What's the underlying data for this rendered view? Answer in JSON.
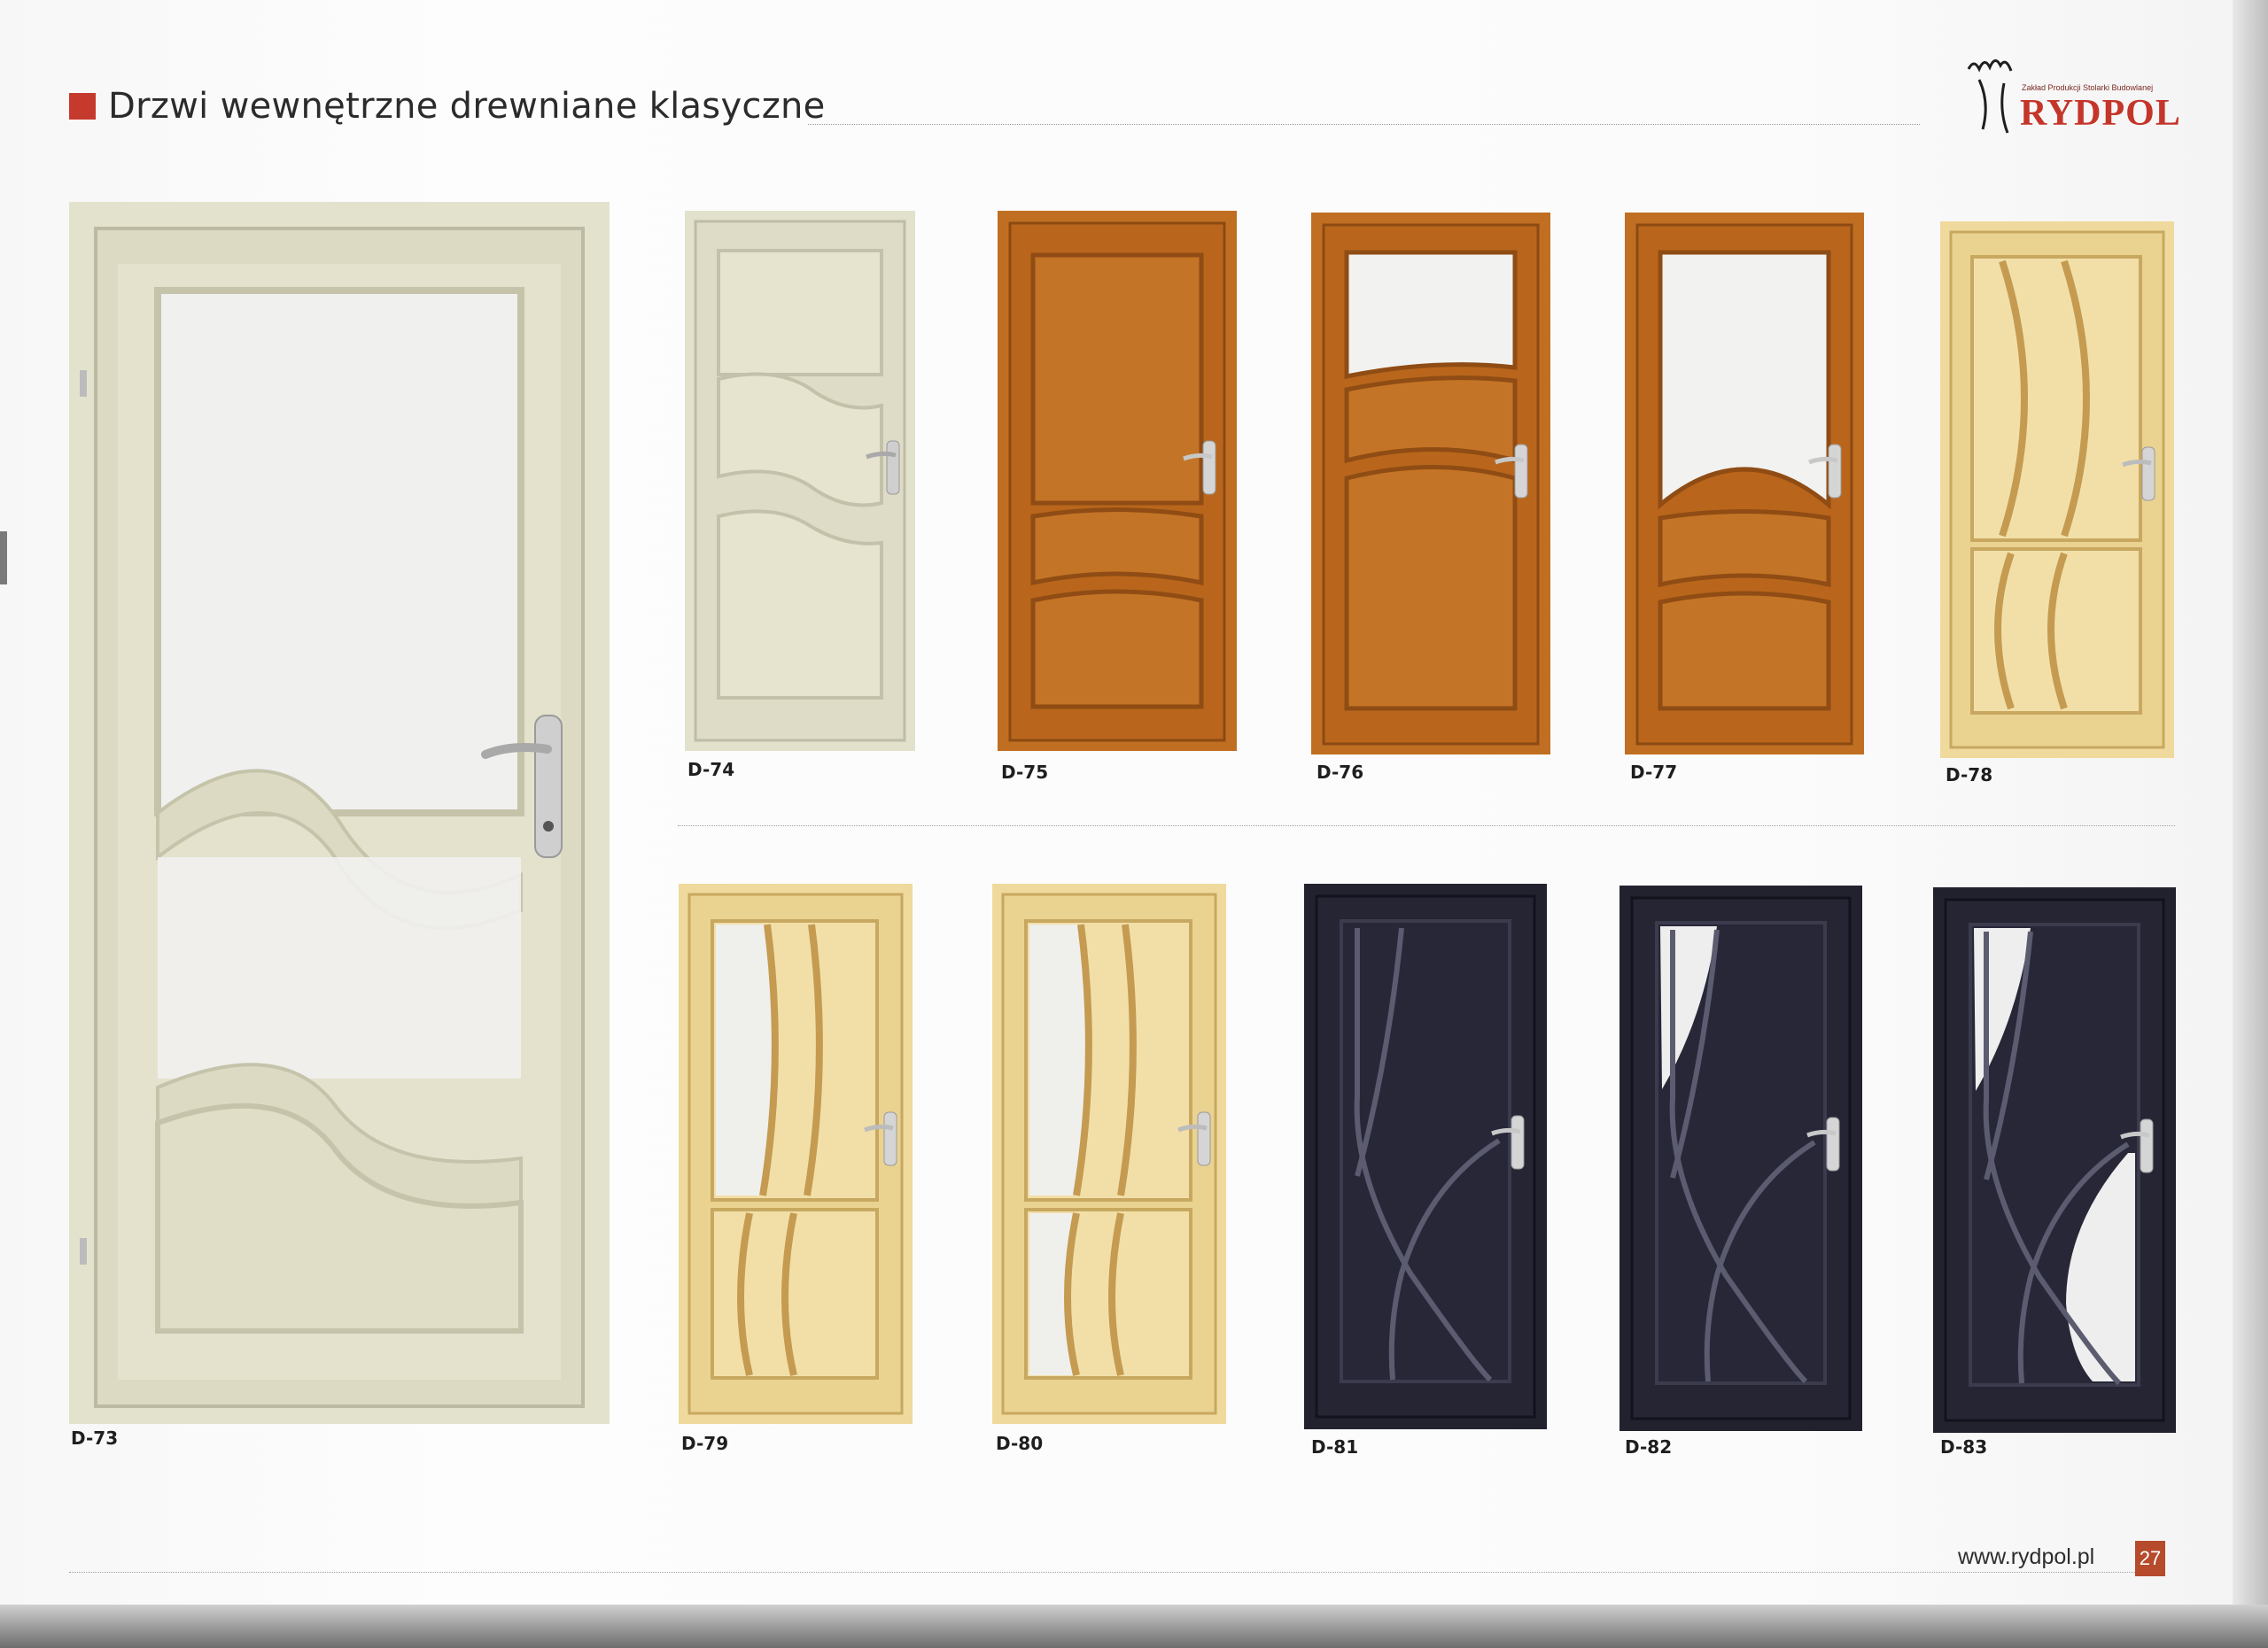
{
  "header": {
    "title": "Drzwi wewnętrzne drewniane klasyczne"
  },
  "logo": {
    "brand": "RYDPOL",
    "tagline": "Zakład Produkcji Stolarki Budowlanej"
  },
  "colors": {
    "accent": "#c63a2e",
    "finish_cream": "#e2e0c9",
    "finish_oak": "#c06f22",
    "finish_pine": "#efd89a",
    "finish_navy": "#232335",
    "glass": "#eeeeee"
  },
  "doors": [
    {
      "code": "D-73",
      "finish": "cream",
      "icon": "door-icon"
    },
    {
      "code": "D-74",
      "finish": "cream",
      "icon": "door-icon"
    },
    {
      "code": "D-75",
      "finish": "oak",
      "icon": "door-icon"
    },
    {
      "code": "D-76",
      "finish": "oak",
      "icon": "door-icon"
    },
    {
      "code": "D-77",
      "finish": "oak",
      "icon": "door-icon"
    },
    {
      "code": "D-78",
      "finish": "pine",
      "icon": "door-icon"
    },
    {
      "code": "D-79",
      "finish": "pine",
      "icon": "door-icon"
    },
    {
      "code": "D-80",
      "finish": "pine",
      "icon": "door-icon"
    },
    {
      "code": "D-81",
      "finish": "navy",
      "icon": "door-icon"
    },
    {
      "code": "D-82",
      "finish": "navy",
      "icon": "door-icon"
    },
    {
      "code": "D-83",
      "finish": "navy",
      "icon": "door-icon"
    }
  ],
  "footer": {
    "url": "www.rydpol.pl",
    "page_number": "27"
  }
}
